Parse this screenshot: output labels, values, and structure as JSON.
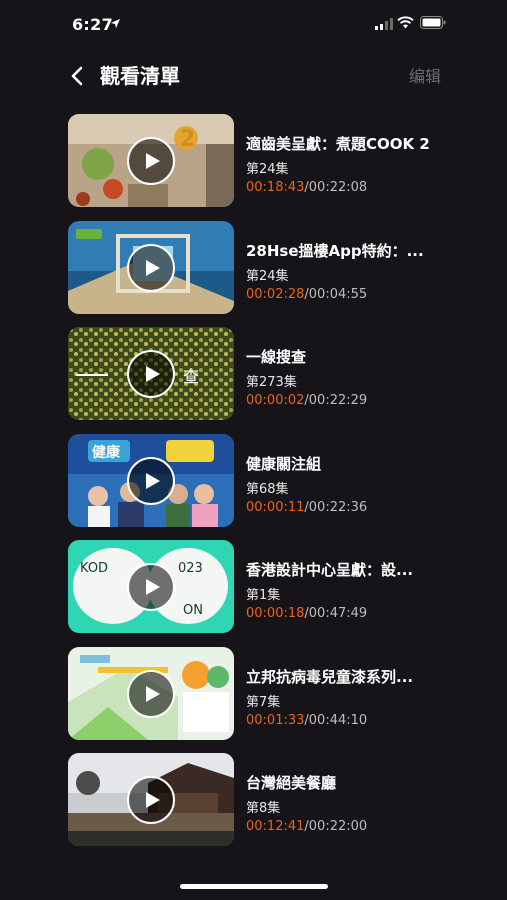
{
  "status": {
    "time": "6:27"
  },
  "nav": {
    "title": "觀看清單",
    "edit": "编辑"
  },
  "items": [
    {
      "title": "適齒美呈獻：煮題COOK 2",
      "episode": "第24集",
      "progress": "00:18:43",
      "total": "/00:22:08"
    },
    {
      "title": "28Hse搵樓App特約：...",
      "episode": "第24集",
      "progress": "00:02:28",
      "total": "/00:04:55"
    },
    {
      "title": "一線搜查",
      "episode": "第273集",
      "progress": "00:00:02",
      "total": "/00:22:29"
    },
    {
      "title": "健康關注組",
      "episode": "第68集",
      "progress": "00:00:11",
      "total": "/00:22:36"
    },
    {
      "title": "香港設計中心呈獻：設...",
      "episode": "第1集",
      "progress": "00:00:18",
      "total": "/00:47:49"
    },
    {
      "title": "立邦抗病毒兒童漆系列...",
      "episode": "第7集",
      "progress": "00:01:33",
      "total": "/00:44:10"
    },
    {
      "title": "台灣絕美餐廳",
      "episode": "第8集",
      "progress": "00:12:41",
      "total": "/00:22:00"
    }
  ],
  "colors": {
    "background": "#161419",
    "progress": "#e8641b",
    "edit": "#6d6c72"
  }
}
